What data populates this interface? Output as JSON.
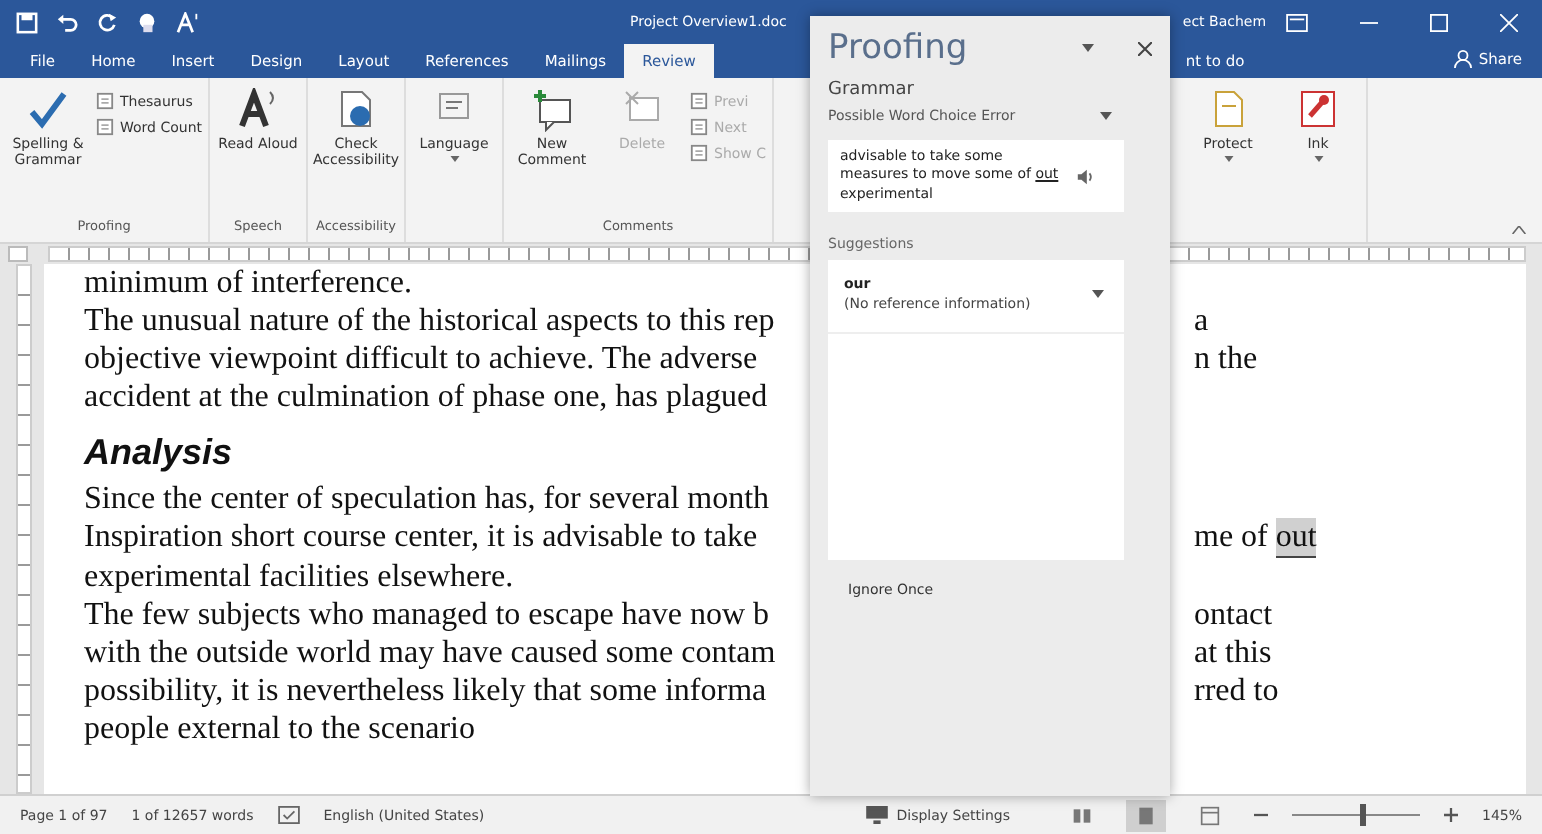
{
  "window": {
    "title": "Project Overview1.doc",
    "user": "ect Bachem"
  },
  "tabs": [
    {
      "label": "File",
      "selected": false
    },
    {
      "label": "Home",
      "selected": false
    },
    {
      "label": "Insert",
      "selected": false
    },
    {
      "label": "Design",
      "selected": false
    },
    {
      "label": "Layout",
      "selected": false
    },
    {
      "label": "References",
      "selected": false
    },
    {
      "label": "Mailings",
      "selected": false
    },
    {
      "label": "Review",
      "selected": true
    }
  ],
  "tell_me": "nt to do",
  "share": "Share",
  "ribbon_left": [
    {
      "label": "Proofing",
      "buttons": [
        {
          "kind": "large",
          "label": "Spelling & Grammar",
          "disabled": false
        },
        {
          "kind": "stack",
          "items": [
            "Thesaurus",
            "Word Count"
          ],
          "disabled": false
        }
      ]
    },
    {
      "label": "Speech",
      "buttons": [
        {
          "kind": "large",
          "label": "Read Aloud",
          "disabled": false
        }
      ]
    },
    {
      "label": "Accessibility",
      "buttons": [
        {
          "kind": "large",
          "label": "Check Accessibility",
          "disabled": false
        }
      ]
    },
    {
      "buttons": [
        {
          "kind": "large",
          "label": "Language",
          "dropdown": true,
          "disabled": false
        }
      ]
    },
    {
      "label": "Comments",
      "buttons": [
        {
          "kind": "large",
          "label": "New Comment",
          "disabled": false
        },
        {
          "kind": "large",
          "label": "Delete",
          "disabled": true
        },
        {
          "kind": "stack",
          "items": [
            "Previ",
            "Next",
            "Show C"
          ],
          "disabled": true
        }
      ]
    }
  ],
  "ribbon_right": [
    {
      "buttons": [
        {
          "kind": "large",
          "label": "Protect",
          "dropdown": true,
          "disabled": false
        },
        {
          "kind": "large",
          "label": "Ink",
          "dropdown": true,
          "disabled": false
        }
      ]
    }
  ],
  "document": [
    {
      "kind": "text",
      "left": "minimum of interference."
    },
    {
      "kind": "text",
      "left": "The unusual nature of the historical aspects to this rep",
      "right": [
        {
          "text": "a",
          "flagged": false
        }
      ]
    },
    {
      "kind": "text",
      "left": "objective viewpoint difficult to achieve. The adverse",
      "right": [
        {
          "text": "n the",
          "flagged": false
        }
      ]
    },
    {
      "kind": "text",
      "left": "accident at the culmination of phase one, has plagued"
    },
    {
      "kind": "heading",
      "left": "Analysis"
    },
    {
      "kind": "text",
      "left": "Since the center of speculation has, for several month"
    },
    {
      "kind": "text",
      "left": "Inspiration short course center, it is advisable to take",
      "right": [
        {
          "text": "me of",
          "flagged": false
        },
        {
          "text": "out",
          "flagged": true
        }
      ]
    },
    {
      "kind": "text",
      "left": "experimental facilities elsewhere."
    },
    {
      "kind": "text",
      "left": "The few subjects who managed to escape have now b",
      "right": [
        {
          "text": "ontact",
          "flagged": false
        }
      ]
    },
    {
      "kind": "text",
      "left": "with the outside world may have caused some contam",
      "right": [
        {
          "text": "at this",
          "flagged": false
        }
      ]
    },
    {
      "kind": "text",
      "left": "possibility, it is nevertheless likely that some informa",
      "right": [
        {
          "text": "rred to",
          "flagged": false
        }
      ]
    },
    {
      "kind": "text",
      "left": "people external to the scenario"
    }
  ],
  "pane": {
    "title": "Proofing",
    "section": "Grammar",
    "issue": "Possible Word Choice Error",
    "context": {
      "before": "advisable to take some measures to move some of",
      "flagged": "out",
      "after": "experimental"
    },
    "suggestions_label": "Suggestions",
    "suggestions": [
      {
        "word": "our",
        "note": "(No reference information)"
      }
    ],
    "action": "Ignore Once"
  },
  "status_bar": {
    "page": "Page 1 of 97",
    "words": "1 of 12657 words",
    "language": "English (United States)",
    "display": "Display Settings",
    "views": [
      {
        "selected": false
      },
      {
        "selected": true
      },
      {
        "selected": false
      }
    ],
    "zoom_slider": {
      "level": 0.55
    },
    "zoom": "145%"
  }
}
